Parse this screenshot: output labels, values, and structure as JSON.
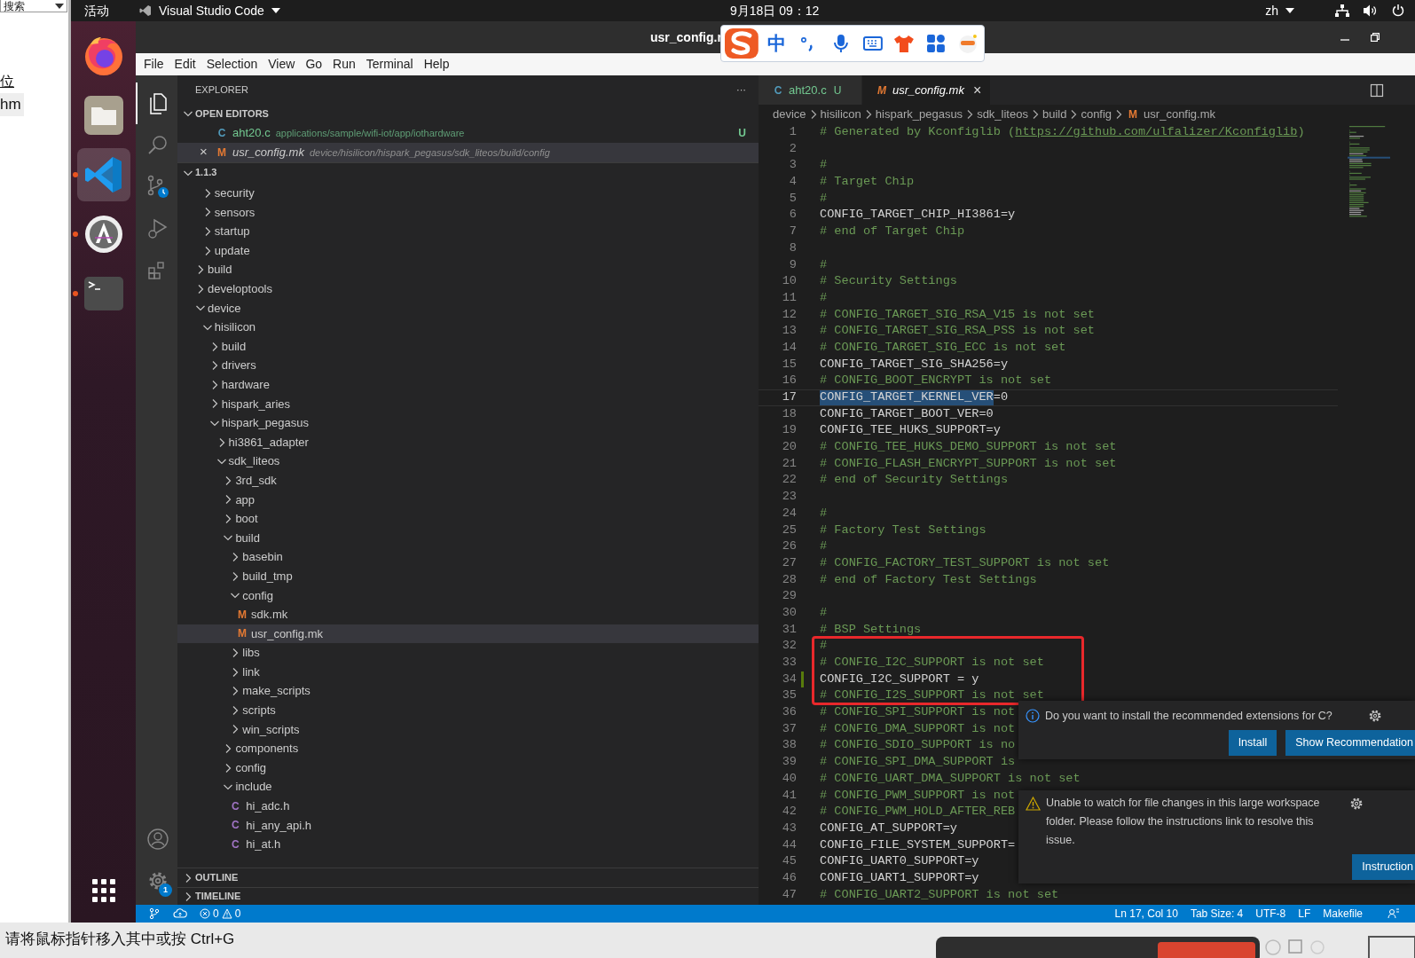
{
  "browser_page": {
    "search_box": "搜索",
    "link": "位",
    "tag": "hm"
  },
  "top_bar": {
    "activities": "活动",
    "app_menu": "Visual Studio Code",
    "clock": "9月18日 09：12",
    "input_method": "zh"
  },
  "dock": {
    "items": [
      {
        "kind": "browser",
        "running": false,
        "selected": false
      },
      {
        "kind": "files",
        "running": false,
        "selected": false
      },
      {
        "kind": "editor",
        "running": true,
        "selected": true
      },
      {
        "kind": "store",
        "running": true,
        "selected": false
      },
      {
        "kind": "terminal",
        "running": true,
        "selected": false
      }
    ]
  },
  "ime_toolbar": {
    "mode": "中"
  },
  "window": {
    "title": "usr_config.r",
    "menu": [
      "File",
      "Edit",
      "Selection",
      "View",
      "Go",
      "Run",
      "Terminal",
      "Help"
    ]
  },
  "activity_bar": {
    "items": [
      {
        "kind": "explorer",
        "selected": true
      },
      {
        "kind": "search",
        "selected": false
      },
      {
        "kind": "source_control",
        "selected": false
      },
      {
        "kind": "run",
        "selected": false
      },
      {
        "kind": "extensions",
        "selected": false
      }
    ],
    "settings_badge": "1"
  },
  "sidebar": {
    "title": "EXPLORER",
    "more": "···",
    "open_editors": {
      "title": "OPEN EDITORS",
      "expanded": true,
      "items": [
        {
          "icon": "C",
          "name": "aht20.c",
          "path": "applications/sample/wifi-iot/app/iothardware",
          "badge": "U",
          "selected": false
        },
        {
          "icon": "M",
          "name": "usr_config.mk",
          "path": "device/hisilicon/hispark_pegasus/sdk_liteos/build/config",
          "close": "×",
          "selected": true
        }
      ]
    },
    "folder": {
      "title": "1.1.3",
      "expanded": true,
      "tree": [
        {
          "kind": "folder",
          "children": [
            {
              "kind": "folder",
              "label": "security",
              "expanded": false,
              "selected": false
            },
            {
              "kind": "folder",
              "label": "sensors",
              "expanded": false,
              "selected": false
            },
            {
              "kind": "folder",
              "label": "startup",
              "expanded": false,
              "selected": false
            },
            {
              "kind": "folder",
              "label": "update",
              "expanded": false,
              "selected": false
            }
          ]
        },
        {
          "kind": "folder",
          "label": "build",
          "expanded": false,
          "selected": false
        },
        {
          "kind": "folder",
          "label": "developtools",
          "expanded": false,
          "selected": false
        },
        {
          "kind": "folder",
          "label": "device",
          "expanded": true,
          "selected": false,
          "children": [
            {
              "kind": "folder",
              "label": "hisilicon",
              "expanded": true,
              "selected": false,
              "children": [
                {
                  "kind": "folder",
                  "label": "build",
                  "expanded": false,
                  "selected": false
                },
                {
                  "kind": "folder",
                  "label": "drivers",
                  "expanded": false,
                  "selected": false
                },
                {
                  "kind": "folder",
                  "label": "hardware",
                  "expanded": false,
                  "selected": false
                },
                {
                  "kind": "folder",
                  "label": "hispark_aries",
                  "expanded": false,
                  "selected": false
                },
                {
                  "kind": "folder",
                  "label": "hispark_pegasus",
                  "expanded": true,
                  "selected": false,
                  "children": [
                    {
                      "kind": "folder",
                      "label": "hi3861_adapter",
                      "expanded": false,
                      "selected": false
                    },
                    {
                      "kind": "folder",
                      "label": "sdk_liteos",
                      "expanded": true,
                      "selected": false,
                      "children": [
                        {
                          "kind": "folder",
                          "label": "3rd_sdk",
                          "expanded": false,
                          "selected": false
                        },
                        {
                          "kind": "folder",
                          "label": "app",
                          "expanded": false,
                          "selected": false
                        },
                        {
                          "kind": "folder",
                          "label": "boot",
                          "expanded": false,
                          "selected": false
                        },
                        {
                          "kind": "folder",
                          "label": "build",
                          "expanded": true,
                          "selected": false,
                          "children": [
                            {
                              "kind": "folder",
                              "label": "basebin",
                              "expanded": false,
                              "selected": false
                            },
                            {
                              "kind": "folder",
                              "label": "build_tmp",
                              "expanded": false,
                              "selected": false
                            },
                            {
                              "kind": "folder",
                              "label": "config",
                              "expanded": true,
                              "selected": false,
                              "children": [
                                {
                                  "kind": "file",
                                  "icon": "M",
                                  "label": "sdk.mk",
                                  "selected": false
                                },
                                {
                                  "kind": "file",
                                  "icon": "M",
                                  "label": "usr_config.mk",
                                  "selected": true
                                }
                              ]
                            },
                            {
                              "kind": "folder",
                              "label": "libs",
                              "expanded": false,
                              "selected": false
                            },
                            {
                              "kind": "folder",
                              "label": "link",
                              "expanded": false,
                              "selected": false
                            },
                            {
                              "kind": "folder",
                              "label": "make_scripts",
                              "expanded": false,
                              "selected": false
                            },
                            {
                              "kind": "folder",
                              "label": "scripts",
                              "expanded": false,
                              "selected": false
                            },
                            {
                              "kind": "folder",
                              "label": "win_scripts",
                              "expanded": false,
                              "selected": false
                            }
                          ]
                        },
                        {
                          "kind": "folder",
                          "label": "components",
                          "expanded": false,
                          "selected": false
                        },
                        {
                          "kind": "folder",
                          "label": "config",
                          "expanded": false,
                          "selected": false
                        },
                        {
                          "kind": "folder",
                          "label": "include",
                          "expanded": true,
                          "selected": false,
                          "children": [
                            {
                              "kind": "file",
                              "icon": "C",
                              "label": "hi_adc.h",
                              "selected": false
                            },
                            {
                              "kind": "file",
                              "icon": "C",
                              "label": "hi_any_api.h",
                              "selected": false
                            },
                            {
                              "kind": "file",
                              "icon": "C",
                              "label": "hi_at.h",
                              "selected": false
                            }
                          ]
                        }
                      ]
                    }
                  ]
                }
              ]
            }
          ]
        }
      ]
    },
    "outline": {
      "title": "OUTLINE",
      "expanded": false
    },
    "timeline": {
      "title": "TIMELINE",
      "expanded": false
    }
  },
  "editor": {
    "tabs": [
      {
        "icon": "C",
        "label": "aht20.c",
        "badge": "U",
        "selected": false
      },
      {
        "icon": "M",
        "label": "usr_config.mk",
        "close": "×",
        "selected": true
      }
    ],
    "breadcrumbs": [
      {
        "label": "device"
      },
      {
        "label": "hisilicon"
      },
      {
        "label": "hispark_pegasus"
      },
      {
        "label": "sdk_liteos"
      },
      {
        "label": "build"
      },
      {
        "label": "config"
      },
      {
        "label": "usr_config.mk",
        "icon": "M"
      }
    ],
    "lines": [
      {
        "n": "1",
        "kind": "comment",
        "text": "# Generated by Kconfiglib (",
        "link": "https://github.com/ulfalizer/Kconfiglib",
        "tail": ")",
        "current": false,
        "modified": false,
        "boxed": false
      },
      {
        "n": "2",
        "kind": "blank",
        "current": false,
        "modified": false,
        "boxed": false
      },
      {
        "n": "3",
        "kind": "comment",
        "text": "#",
        "current": false,
        "modified": false,
        "boxed": false
      },
      {
        "n": "4",
        "kind": "comment",
        "text": "# Target Chip",
        "current": false,
        "modified": false,
        "boxed": false
      },
      {
        "n": "5",
        "kind": "comment",
        "text": "#",
        "current": false,
        "modified": false,
        "boxed": false
      },
      {
        "n": "6",
        "kind": "code",
        "text": "CONFIG_TARGET_CHIP_HI3861=y",
        "current": false,
        "modified": false,
        "boxed": false
      },
      {
        "n": "7",
        "kind": "comment",
        "text": "# end of Target Chip",
        "current": false,
        "modified": false,
        "boxed": false
      },
      {
        "n": "8",
        "kind": "blank",
        "current": false,
        "modified": false,
        "boxed": false
      },
      {
        "n": "9",
        "kind": "comment",
        "text": "#",
        "current": false,
        "modified": false,
        "boxed": false
      },
      {
        "n": "10",
        "kind": "comment",
        "text": "# Security Settings",
        "current": false,
        "modified": false,
        "boxed": false
      },
      {
        "n": "11",
        "kind": "comment",
        "text": "#",
        "current": false,
        "modified": false,
        "boxed": false
      },
      {
        "n": "12",
        "kind": "comment",
        "text": "# CONFIG_TARGET_SIG_RSA_V15 is not set",
        "current": false,
        "modified": false,
        "boxed": false
      },
      {
        "n": "13",
        "kind": "comment",
        "text": "# CONFIG_TARGET_SIG_RSA_PSS is not set",
        "current": false,
        "modified": false,
        "boxed": false
      },
      {
        "n": "14",
        "kind": "comment",
        "text": "# CONFIG_TARGET_SIG_ECC is not set",
        "current": false,
        "modified": false,
        "boxed": false
      },
      {
        "n": "15",
        "kind": "code",
        "text": "CONFIG_TARGET_SIG_SHA256=y",
        "current": false,
        "modified": false,
        "boxed": false
      },
      {
        "n": "16",
        "kind": "comment",
        "text": "# CONFIG_BOOT_ENCRYPT is not set",
        "current": false,
        "modified": false,
        "boxed": false
      },
      {
        "n": "17",
        "kind": "code",
        "selection": "CONFIG_TARGET_KERNEL_VER",
        "text": "=0",
        "current": true,
        "modified": false,
        "boxed": false
      },
      {
        "n": "18",
        "kind": "code",
        "text": "CONFIG_TARGET_BOOT_VER=0",
        "current": false,
        "modified": false,
        "boxed": false
      },
      {
        "n": "19",
        "kind": "code",
        "text": "CONFIG_TEE_HUKS_SUPPORT=y",
        "current": false,
        "modified": false,
        "boxed": false
      },
      {
        "n": "20",
        "kind": "comment",
        "text": "# CONFIG_TEE_HUKS_DEMO_SUPPORT is not set",
        "current": false,
        "modified": false,
        "boxed": false
      },
      {
        "n": "21",
        "kind": "comment",
        "text": "# CONFIG_FLASH_ENCRYPT_SUPPORT is not set",
        "current": false,
        "modified": false,
        "boxed": false
      },
      {
        "n": "22",
        "kind": "comment",
        "text": "# end of Security Settings",
        "current": false,
        "modified": false,
        "boxed": false
      },
      {
        "n": "23",
        "kind": "blank",
        "current": false,
        "modified": false,
        "boxed": false
      },
      {
        "n": "24",
        "kind": "comment",
        "text": "#",
        "current": false,
        "modified": false,
        "boxed": false
      },
      {
        "n": "25",
        "kind": "comment",
        "text": "# Factory Test Settings",
        "current": false,
        "modified": false,
        "boxed": false
      },
      {
        "n": "26",
        "kind": "comment",
        "text": "#",
        "current": false,
        "modified": false,
        "boxed": false
      },
      {
        "n": "27",
        "kind": "comment",
        "text": "# CONFIG_FACTORY_TEST_SUPPORT is not set",
        "current": false,
        "modified": false,
        "boxed": false
      },
      {
        "n": "28",
        "kind": "comment",
        "text": "# end of Factory Test Settings",
        "current": false,
        "modified": false,
        "boxed": false
      },
      {
        "n": "29",
        "kind": "blank",
        "current": false,
        "modified": false,
        "boxed": false
      },
      {
        "n": "30",
        "kind": "comment",
        "text": "#",
        "current": false,
        "modified": false,
        "boxed": false
      },
      {
        "n": "31",
        "kind": "comment",
        "text": "# BSP Settings",
        "current": false,
        "modified": false,
        "boxed": false
      },
      {
        "n": "32",
        "kind": "comment",
        "text": "#",
        "current": false,
        "modified": false,
        "boxed": true
      },
      {
        "n": "33",
        "kind": "comment",
        "text": "# CONFIG_I2C_SUPPORT is not set",
        "current": false,
        "modified": false,
        "boxed": true
      },
      {
        "n": "34",
        "kind": "code",
        "text": "CONFIG_I2C_SUPPORT = y",
        "current": false,
        "modified": true,
        "boxed": true
      },
      {
        "n": "35",
        "kind": "comment",
        "text": "# CONFIG_I2S_SUPPORT is not set",
        "current": false,
        "modified": false,
        "boxed": true
      },
      {
        "n": "36",
        "kind": "comment",
        "text": "# CONFIG_SPI_SUPPORT is not",
        "current": false,
        "modified": false,
        "boxed": false
      },
      {
        "n": "37",
        "kind": "comment",
        "text": "# CONFIG_DMA_SUPPORT is not",
        "current": false,
        "modified": false,
        "boxed": false
      },
      {
        "n": "38",
        "kind": "comment",
        "text": "# CONFIG_SDIO_SUPPORT is no",
        "current": false,
        "modified": false,
        "boxed": false
      },
      {
        "n": "39",
        "kind": "comment",
        "text": "# CONFIG_SPI_DMA_SUPPORT is",
        "current": false,
        "modified": false,
        "boxed": false
      },
      {
        "n": "40",
        "kind": "comment",
        "text": "# CONFIG_UART_DMA_SUPPORT is not set",
        "current": false,
        "modified": false,
        "boxed": false
      },
      {
        "n": "41",
        "kind": "comment",
        "text": "# CONFIG_PWM_SUPPORT is not",
        "current": false,
        "modified": false,
        "boxed": false
      },
      {
        "n": "42",
        "kind": "comment",
        "text": "# CONFIG_PWM_HOLD_AFTER_REB",
        "current": false,
        "modified": false,
        "boxed": false
      },
      {
        "n": "43",
        "kind": "code",
        "text": "CONFIG_AT_SUPPORT=y",
        "current": false,
        "modified": false,
        "boxed": false
      },
      {
        "n": "44",
        "kind": "code",
        "text": "CONFIG_FILE_SYSTEM_SUPPORT=",
        "current": false,
        "modified": false,
        "boxed": false
      },
      {
        "n": "45",
        "kind": "code",
        "text": "CONFIG_UART0_SUPPORT=y",
        "current": false,
        "modified": false,
        "boxed": false
      },
      {
        "n": "46",
        "kind": "code",
        "text": "CONFIG_UART1_SUPPORT=y",
        "current": false,
        "modified": false,
        "boxed": false
      },
      {
        "n": "47",
        "kind": "comment",
        "text": "# CONFIG_UART2_SUPPORT is not set",
        "current": false,
        "modified": false,
        "boxed": false
      }
    ]
  },
  "notifications": [
    {
      "kind": "info",
      "message": "Do you want to install the recommended extensions for C?",
      "actions": [
        "Install",
        "Show Recommendation"
      ]
    },
    {
      "kind": "warning",
      "message": "Unable to watch for file changes in this large workspace folder. Please follow the instructions link to resolve this issue.",
      "actions": [
        "Instruction"
      ]
    }
  ],
  "status_bar": {
    "errors": "0",
    "warnings": "0",
    "items": [
      "Ln 17, Col 10",
      "Tab Size: 4",
      "UTF-8",
      "LF",
      "Makefile"
    ]
  },
  "bottom_bar": {
    "hint": "请将鼠标指针移入其中或按 Ctrl+G"
  }
}
